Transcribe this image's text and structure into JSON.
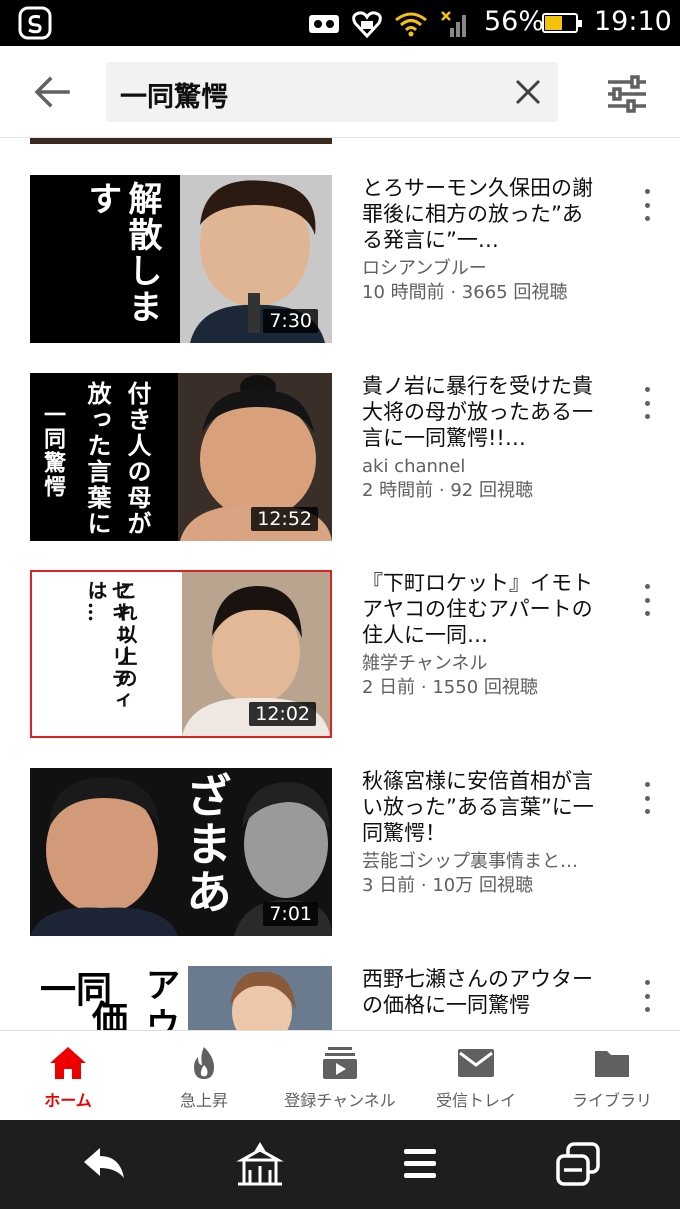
{
  "status_bar": {
    "battery_percent": "56%",
    "battery_level": 0.56,
    "clock": "19:10",
    "icons": [
      "app-logo-icon",
      "voicemail-icon",
      "heart-app-icon",
      "wifi-icon",
      "signal-icon",
      "battery-icon"
    ]
  },
  "search": {
    "query": "一同驚愕",
    "icons": {
      "back": "arrow-left-icon",
      "clear": "close-icon",
      "filter": "sliders-icon"
    }
  },
  "videos": [
    {
      "title": "とろサーモン久保田の謝罪後に相方の放った”ある発言に”一…",
      "channel": "ロシアンブルー",
      "meta": "10 時間前 · 3665 回視聴",
      "duration": "7:30",
      "thumb_text": "解散します"
    },
    {
      "title": "貴ノ岩に暴行を受けた貴大将の母が放ったある一言に一同驚愕!!…",
      "channel": "aki channel",
      "meta": "2 時間前 · 92 回視聴",
      "duration": "12:52",
      "thumb_text_a": "付き人の母が",
      "thumb_text_b": "放った言葉に",
      "thumb_text_c": "一同驚愕"
    },
    {
      "title": "『下町ロケット』イモトアヤコの住むアパートの住人に一同…",
      "channel": "雑学チャンネル",
      "meta": "2 日前 · 1550 回視聴",
      "duration": "12:02",
      "thumb_text_a": "これ以上の",
      "thumb_text_b": "セキュリティは…"
    },
    {
      "title": "秋篠宮様に安倍首相が言い放った”ある言葉”に一同驚愕！",
      "channel": "芸能ゴシップ裏事情まと…",
      "meta": "3 日前 · 10万 回視聴",
      "duration": "7:01",
      "thumb_text": "ざまあ"
    },
    {
      "title": "西野七瀬さんのアウターの価格に一同驚愕",
      "channel": "",
      "meta": "",
      "duration": "",
      "thumb_text_a": "一同",
      "thumb_text_b": "価",
      "thumb_text_c": "アウ"
    }
  ],
  "bottom_nav": [
    {
      "label": "ホーム",
      "icon": "home-icon",
      "active": true
    },
    {
      "label": "急上昇",
      "icon": "flame-icon",
      "active": false
    },
    {
      "label": "登録チャンネル",
      "icon": "subscriptions-icon",
      "active": false
    },
    {
      "label": "受信トレイ",
      "icon": "mail-icon",
      "active": false
    },
    {
      "label": "ライブラリ",
      "icon": "folder-icon",
      "active": false
    }
  ],
  "system_nav": [
    "back-icon",
    "home-temple-icon",
    "menu-icon",
    "recent-apps-icon"
  ],
  "colors": {
    "accent": "#ff0000",
    "text": "#0f0f0f",
    "secondary_text": "#606060"
  }
}
